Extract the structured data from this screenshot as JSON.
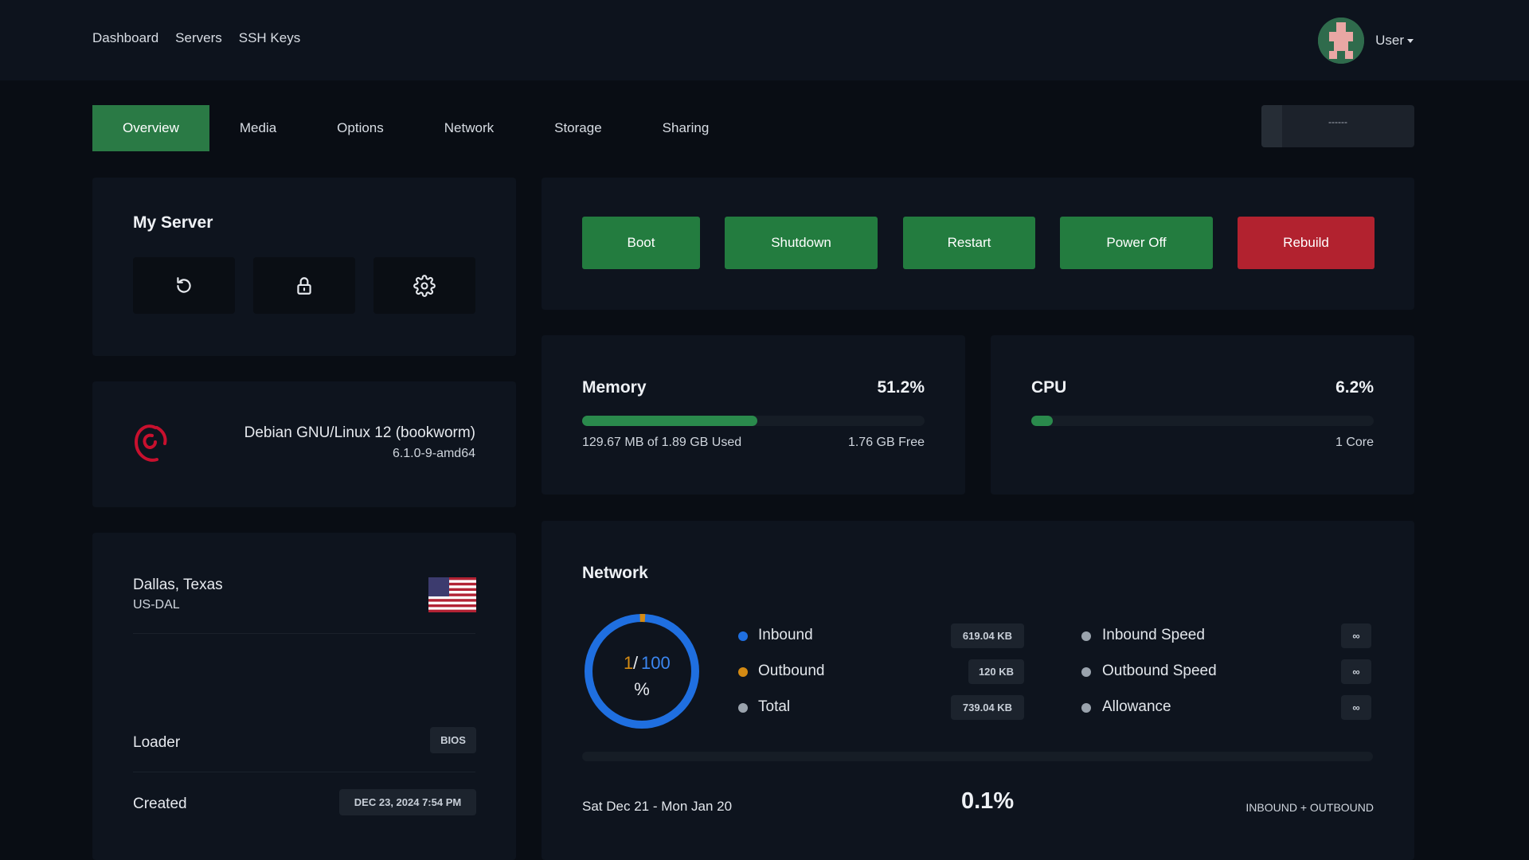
{
  "nav": {
    "links": [
      "Dashboard",
      "Servers",
      "SSH Keys"
    ],
    "user_label": "User"
  },
  "tabs": [
    "Overview",
    "Media",
    "Options",
    "Network",
    "Storage",
    "Sharing"
  ],
  "tab_select_value": "------",
  "server": {
    "title": "My Server"
  },
  "os": {
    "name": "Debian GNU/Linux 12 (bookworm)",
    "kernel": "6.1.0-9-amd64"
  },
  "location": {
    "city": "Dallas, Texas",
    "code": "US-DAL"
  },
  "loader": {
    "label": "Loader",
    "value": "BIOS"
  },
  "created": {
    "label": "Created",
    "value": "DEC 23, 2024 7:54 PM"
  },
  "actions": {
    "boot": "Boot",
    "shutdown": "Shutdown",
    "restart": "Restart",
    "poweroff": "Power Off",
    "rebuild": "Rebuild"
  },
  "memory": {
    "label": "Memory",
    "percent_text": "51.2%",
    "percent": 51.2,
    "used": "129.67 MB of 1.89 GB Used",
    "free": "1.76 GB Free"
  },
  "cpu": {
    "label": "CPU",
    "percent_text": "6.2%",
    "percent": 6.2,
    "cores": "1 Core"
  },
  "network": {
    "title": "Network",
    "donut": {
      "used": "1",
      "sep": "/",
      "total": "100",
      "unit": "%",
      "fraction": 0.01
    },
    "inbound": {
      "label": "Inbound",
      "value": "619.04 KB"
    },
    "outbound": {
      "label": "Outbound",
      "value": "120 KB"
    },
    "total": {
      "label": "Total",
      "value": "739.04 KB"
    },
    "inbound_speed": {
      "label": "Inbound Speed",
      "value": "∞"
    },
    "outbound_speed": {
      "label": "Outbound Speed",
      "value": "∞"
    },
    "allowance": {
      "label": "Allowance",
      "value": "∞"
    },
    "range": "Sat Dec 21 - Mon Jan 20",
    "usage_percent": "0.1%",
    "usage_caption": "INBOUND + OUTBOUND"
  },
  "colors": {
    "green": "#237c3f",
    "red": "#b2222f",
    "inbound": "#1f6fe0",
    "outbound": "#d48a13",
    "muted": "#9aa3ad"
  }
}
